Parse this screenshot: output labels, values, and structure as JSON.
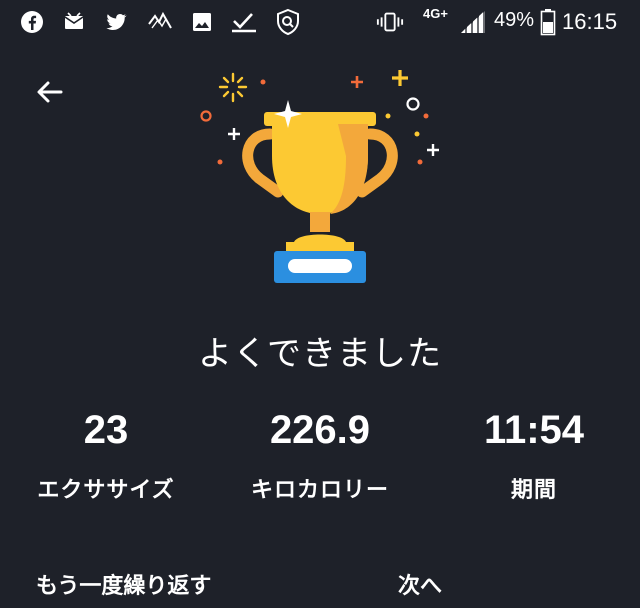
{
  "status_bar": {
    "network": "4G+",
    "battery": "49%",
    "time": "16:15",
    "icons": [
      "facebook-icon",
      "mail-icon",
      "twitter-icon",
      "app-icon",
      "image-icon",
      "check-icon",
      "shield-search-icon",
      "vibrate-icon",
      "signal-icon",
      "battery-icon"
    ]
  },
  "header": {
    "back_icon": "arrow-left-icon"
  },
  "hero": {
    "icon": "trophy-icon",
    "title": "よくできました"
  },
  "stats": [
    {
      "value": "23",
      "label": "エクササイズ"
    },
    {
      "value": "226.9",
      "label": "キロカロリー"
    },
    {
      "value": "11:54",
      "label": "期間"
    }
  ],
  "bottom_actions": {
    "left_label": "もう一度繰り返す",
    "right_label": "次へ"
  },
  "colors": {
    "background": "#1e2129",
    "trophy_gold": "#fcc933",
    "trophy_shade": "#f3a83b",
    "base_blue": "#2b8fe0",
    "accent_orange": "#f26b3a"
  }
}
